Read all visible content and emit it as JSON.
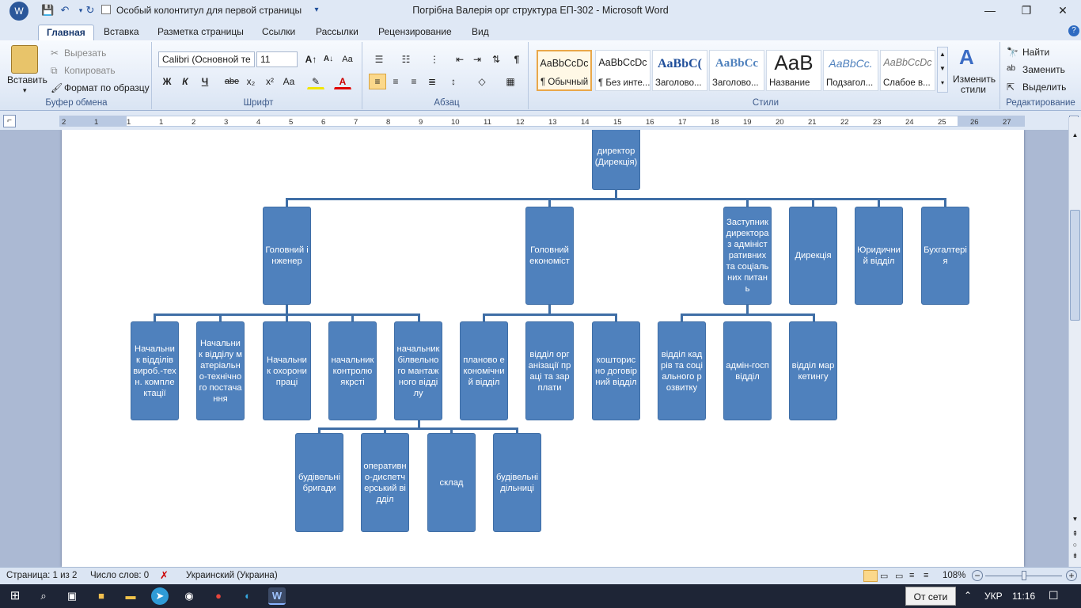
{
  "window": {
    "title": "Погрібна Валерія орг структура ЕП-302 - Microsoft Word",
    "quick_access_check": "Особый колонтитул для первой страницы"
  },
  "tabs": [
    "Главная",
    "Вставка",
    "Разметка страницы",
    "Ссылки",
    "Рассылки",
    "Рецензирование",
    "Вид"
  ],
  "ribbon": {
    "clipboard": {
      "paste": "Вставить",
      "cut": "Вырезать",
      "copy": "Копировать",
      "format_painter": "Формат по образцу",
      "label": "Буфер обмена"
    },
    "font": {
      "name": "Calibri (Основной те",
      "size": "11",
      "label": "Шрифт",
      "bold": "Ж",
      "italic": "К",
      "underline": "Ч",
      "strike": "abe",
      "sub": "x₂",
      "sup": "x²",
      "case": "Aa"
    },
    "paragraph": {
      "label": "Абзац"
    },
    "styles": {
      "label": "Стили",
      "items": [
        {
          "preview": "AaBbCcDc",
          "name": "¶ Обычный"
        },
        {
          "preview": "AaBbCcDc",
          "name": "¶ Без инте..."
        },
        {
          "preview": "AaBbC(",
          "name": "Заголово..."
        },
        {
          "preview": "AaBbCc",
          "name": "Заголово..."
        },
        {
          "preview": "AaB",
          "name": "Название"
        },
        {
          "preview": "AaBbCc.",
          "name": "Подзагол..."
        },
        {
          "preview": "AaBbCcDc",
          "name": "Слабое в..."
        }
      ],
      "change": "Изменить стили"
    },
    "editing": {
      "find": "Найти",
      "replace": "Заменить",
      "select": "Выделить",
      "label": "Редактирование"
    }
  },
  "ruler_marks": [
    "2",
    "1",
    "1",
    "1",
    "2",
    "3",
    "4",
    "5",
    "6",
    "7",
    "8",
    "9",
    "10",
    "11",
    "12",
    "13",
    "14",
    "15",
    "16",
    "17",
    "18",
    "19",
    "20",
    "21",
    "22",
    "23",
    "24",
    "25",
    "26",
    "27"
  ],
  "org": {
    "top": "директор (Дирекція)",
    "level1": [
      "Головний інженер",
      "Головний економіст",
      "Заступник директора з адміністративних та соціальних питань",
      "Дирекція",
      "Юридичний відділ",
      "Бухгалтерія"
    ],
    "engineer_depts": [
      "Начальник відділів вироб.-техн. комплектації",
      "Начальник відділу матеріально-технічного постачання",
      "Начальник охорони праці",
      "начальник контролю якрсті",
      "начальник білвельного мантажного відділу"
    ],
    "economist_depts": [
      "планово економічний відділ",
      "відділ організації праці та зарплати",
      "кошторисно договірний відділ"
    ],
    "deputy_depts": [
      "відділ кадрів та соціального розвитку",
      "адмін-госп відділ",
      "відділ маркетингу"
    ],
    "construction_units": [
      "будівельні бригади",
      "оперативно-диспетчерський відділ",
      "склад",
      "будівельні дільниці"
    ]
  },
  "status": {
    "page": "Страница: 1 из 2",
    "words": "Число слов: 0",
    "lang": "Украинский (Украина)",
    "zoom": "108%"
  },
  "taskbar": {
    "network": "От сети",
    "lang": "УКР",
    "time": "11:16"
  }
}
